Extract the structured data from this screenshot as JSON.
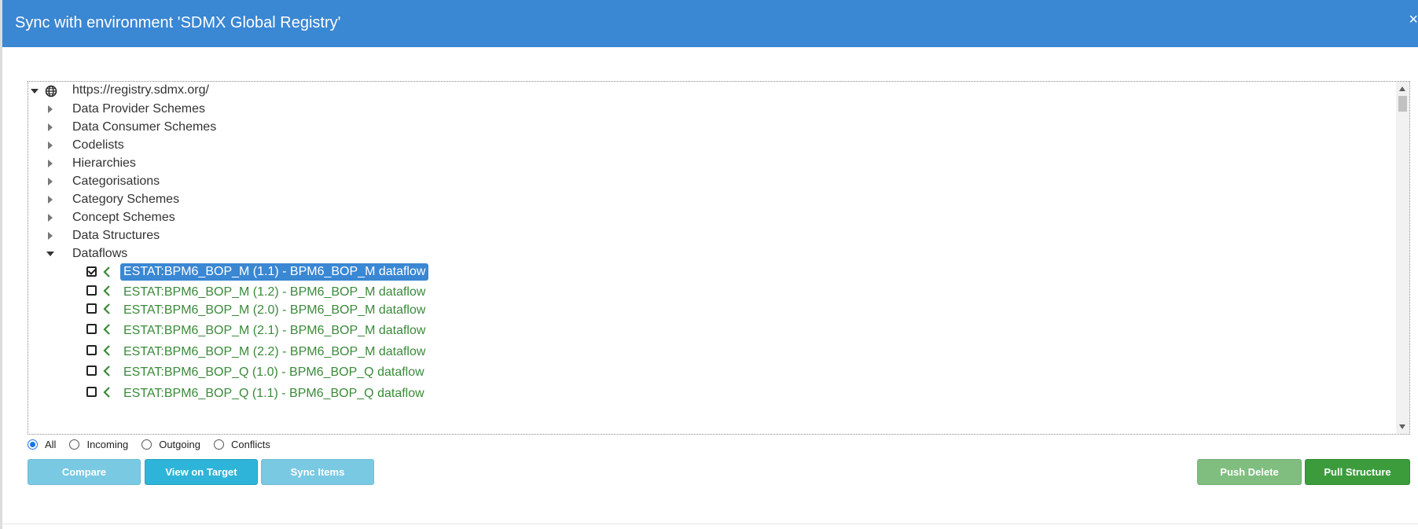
{
  "dialog": {
    "title": "Sync with environment 'SDMX Global Registry'",
    "close_label": "×"
  },
  "tree": {
    "root": {
      "label": "https://registry.sdmx.org/",
      "icon": "globe-icon"
    },
    "categories": [
      {
        "label": "Data Provider Schemes",
        "expanded": false
      },
      {
        "label": "Data Consumer Schemes",
        "expanded": false
      },
      {
        "label": "Codelists",
        "expanded": false
      },
      {
        "label": "Hierarchies",
        "expanded": false
      },
      {
        "label": "Categorisations",
        "expanded": false
      },
      {
        "label": "Category Schemes",
        "expanded": false
      },
      {
        "label": "Concept Schemes",
        "expanded": false
      },
      {
        "label": "Data Structures",
        "expanded": false
      },
      {
        "label": "Dataflows",
        "expanded": true
      }
    ],
    "dataflows": [
      {
        "label": "ESTAT:BPM6_BOP_M (1.1) - BPM6_BOP_M dataflow",
        "checked": true,
        "selected": true
      },
      {
        "label": "ESTAT:BPM6_BOP_M (1.2) - BPM6_BOP_M dataflow",
        "checked": false,
        "selected": false
      },
      {
        "label": "ESTAT:BPM6_BOP_M (2.0) - BPM6_BOP_M dataflow",
        "checked": false,
        "selected": false
      },
      {
        "label": "ESTAT:BPM6_BOP_M (2.1) - BPM6_BOP_M dataflow",
        "checked": false,
        "selected": false
      },
      {
        "label": "ESTAT:BPM6_BOP_M (2.2) - BPM6_BOP_M dataflow",
        "checked": false,
        "selected": false
      },
      {
        "label": "ESTAT:BPM6_BOP_Q (1.0) - BPM6_BOP_Q dataflow",
        "checked": false,
        "selected": false
      },
      {
        "label": "ESTAT:BPM6_BOP_Q (1.1) - BPM6_BOP_Q dataflow",
        "checked": false,
        "selected": false
      }
    ]
  },
  "filters": [
    {
      "label": "All",
      "selected": true
    },
    {
      "label": "Incoming",
      "selected": false
    },
    {
      "label": "Outgoing",
      "selected": false
    },
    {
      "label": "Conflicts",
      "selected": false
    }
  ],
  "buttons": {
    "compare": "Compare",
    "view_on_target": "View on Target",
    "sync_items": "Sync Items",
    "push_delete": "Push Delete",
    "pull_structure": "Pull Structure"
  },
  "colors": {
    "header": "#3a87d3",
    "dataflow_text": "#3a8a3a",
    "selected_bg": "#3a87d3",
    "green_button": "#3c9c3c"
  }
}
